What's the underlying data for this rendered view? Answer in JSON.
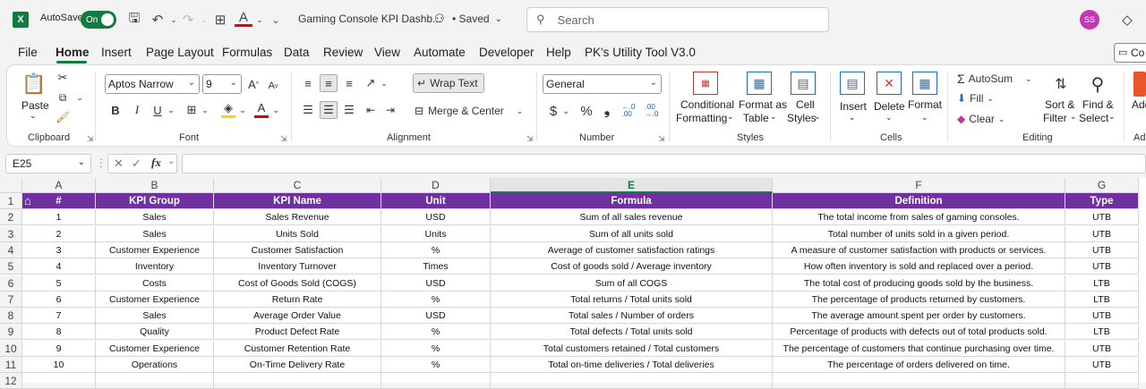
{
  "title_bar": {
    "app_icon": "X",
    "autosave_label": "AutoSave",
    "autosave_state": "On",
    "document_title": "Gaming Console KPI Dashb...",
    "save_status": "• Saved",
    "search_placeholder": "Search",
    "user_initials": "SS"
  },
  "menu": [
    "File",
    "Home",
    "Insert",
    "Page Layout",
    "Formulas",
    "Data",
    "Review",
    "View",
    "Automate",
    "Developer",
    "Help",
    "PK's Utility Tool V3.0"
  ],
  "menu_active": "Home",
  "comments_label": "Co",
  "ribbon": {
    "clipboard": {
      "paste": "Paste",
      "label": "Clipboard"
    },
    "font": {
      "family": "Aptos Narrow",
      "size": "9",
      "bold": "B",
      "italic": "I",
      "underline": "U",
      "label": "Font"
    },
    "alignment": {
      "wrap_text": "Wrap Text",
      "merge_center": "Merge & Center",
      "label": "Alignment"
    },
    "number": {
      "format": "General",
      "currency": "$",
      "percent": "%",
      "comma": "❟",
      "label": "Number"
    },
    "styles": {
      "conditional_1": "Conditional",
      "conditional_2": "Formatting",
      "format_table_1": "Format as",
      "format_table_2": "Table",
      "cell_styles_1": "Cell",
      "cell_styles_2": "Styles",
      "label": "Styles"
    },
    "cells": {
      "insert": "Insert",
      "delete": "Delete",
      "format": "Format",
      "label": "Cells"
    },
    "editing": {
      "autosum": "AutoSum",
      "fill": "Fill",
      "clear": "Clear",
      "sort_1": "Sort &",
      "sort_2": "Filter",
      "find_1": "Find &",
      "find_2": "Select",
      "label": "Editing"
    },
    "addins": {
      "label": "Add",
      "label2": "Add"
    }
  },
  "formula_bar": {
    "name_box": "E25",
    "fx": "fx",
    "formula": ""
  },
  "columns": [
    "A",
    "B",
    "C",
    "D",
    "E",
    "F",
    "G"
  ],
  "selected_column": "E",
  "rows": [
    "1",
    "2",
    "3",
    "4",
    "5",
    "6",
    "7",
    "8",
    "9",
    "10",
    "11",
    "12"
  ],
  "table": {
    "headers": [
      "#",
      "KPI Group",
      "KPI Name",
      "Unit",
      "Formula",
      "Definition",
      "Type"
    ],
    "data": [
      [
        "1",
        "Sales",
        "Sales Revenue",
        "USD",
        "Sum of all sales revenue",
        "The total income from sales of gaming consoles.",
        "UTB"
      ],
      [
        "2",
        "Sales",
        "Units Sold",
        "Units",
        "Sum of all units sold",
        "Total number of units sold in a given period.",
        "UTB"
      ],
      [
        "3",
        "Customer Experience",
        "Customer Satisfaction",
        "%",
        "Average of customer satisfaction ratings",
        "A measure of customer satisfaction with products or services.",
        "UTB"
      ],
      [
        "4",
        "Inventory",
        "Inventory Turnover",
        "Times",
        "Cost of goods sold / Average inventory",
        "How often inventory is sold and replaced over a period.",
        "UTB"
      ],
      [
        "5",
        "Costs",
        "Cost of Goods Sold (COGS)",
        "USD",
        "Sum of all COGS",
        "The total cost of producing goods sold by the business.",
        "LTB"
      ],
      [
        "6",
        "Customer Experience",
        "Return Rate",
        "%",
        "Total returns / Total units sold",
        "The percentage of products returned by customers.",
        "LTB"
      ],
      [
        "7",
        "Sales",
        "Average Order Value",
        "USD",
        "Total sales / Number of orders",
        "The average amount spent per order by customers.",
        "UTB"
      ],
      [
        "8",
        "Quality",
        "Product Defect Rate",
        "%",
        "Total defects / Total units sold",
        "Percentage of products with defects out of total products sold.",
        "LTB"
      ],
      [
        "9",
        "Customer Experience",
        "Customer Retention Rate",
        "%",
        "Total customers retained / Total customers",
        "The percentage of customers that continue purchasing over time.",
        "UTB"
      ],
      [
        "10",
        "Operations",
        "On-Time Delivery Rate",
        "%",
        "Total on-time deliveries / Total deliveries",
        "The percentage of orders delivered on time.",
        "UTB"
      ]
    ]
  },
  "colors": {
    "header_fill": "#7030a0",
    "accent": "#107c41"
  }
}
